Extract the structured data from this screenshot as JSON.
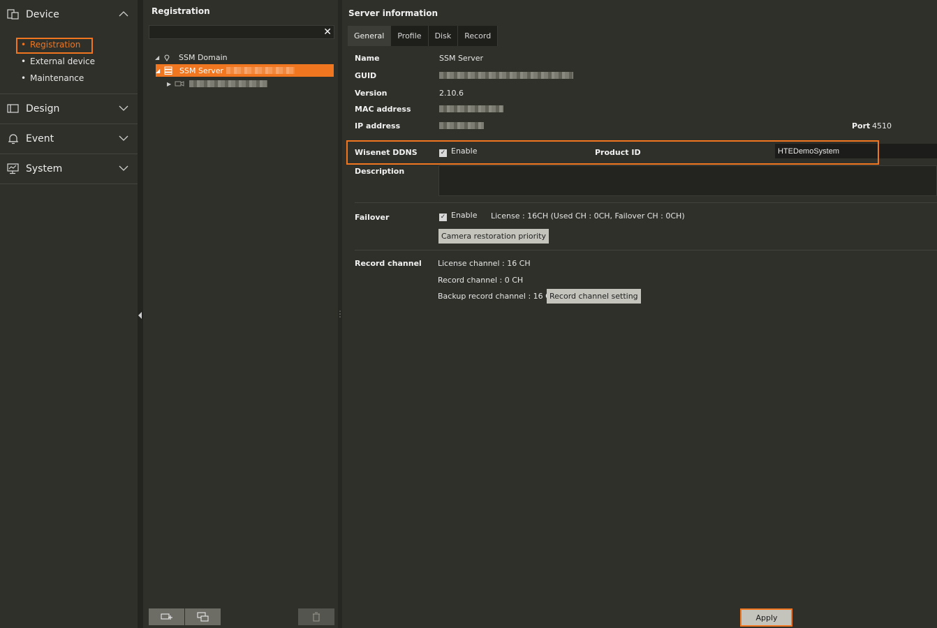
{
  "nav": {
    "sections": [
      {
        "label": "Device",
        "items": [
          "Registration",
          "External device",
          "Maintenance"
        ]
      },
      {
        "label": "Design"
      },
      {
        "label": "Event"
      },
      {
        "label": "System"
      }
    ]
  },
  "registration": {
    "title": "Registration",
    "search_value": "",
    "tree": {
      "domain": "SSM Domain",
      "server": "SSM Server"
    }
  },
  "server_info": {
    "title": "Server information",
    "tabs": [
      "General",
      "Profile",
      "Disk",
      "Record"
    ],
    "name_label": "Name",
    "name_value": "SSM Server",
    "guid_label": "GUID",
    "version_label": "Version",
    "version_value": "2.10.6",
    "mac_label": "MAC address",
    "ip_label": "IP address",
    "port_label": "Port",
    "port_value": "4510",
    "ddns_label": "Wisenet DDNS",
    "ddns_enable": "Enable",
    "product_id_label": "Product ID",
    "product_id_value": "HTEDemoSystem",
    "description_label": "Description",
    "failover_label": "Failover",
    "failover_enable": "Enable",
    "license_text": "License : 16CH (Used CH : 0CH, Failover CH : 0CH)",
    "camera_restoration_button": "Camera restoration priority",
    "record_channel_label": "Record channel",
    "license_channel": "License channel : 16 CH",
    "record_channel": "Record channel : 0 CH",
    "backup_record_channel": "Backup record channel : 16 CH",
    "record_channel_setting_button": "Record channel setting",
    "apply_button": "Apply"
  },
  "colors": {
    "accent": "#f0761f",
    "panel": "#30302b"
  }
}
